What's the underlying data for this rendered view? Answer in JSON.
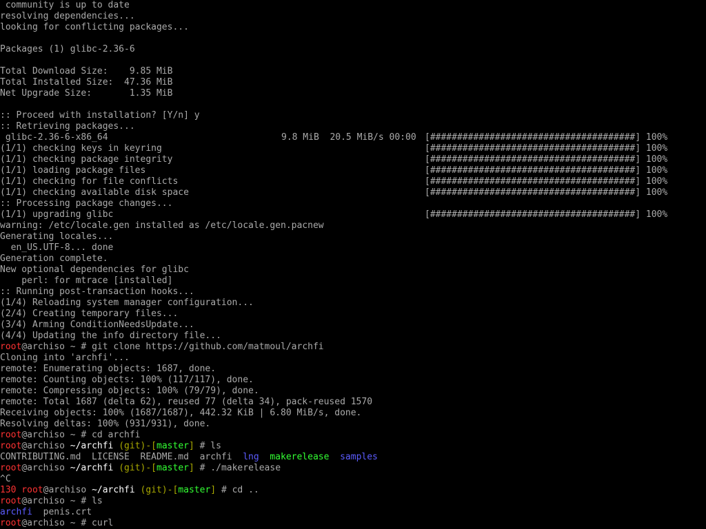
{
  "colors": {
    "background": "#000000",
    "text": "#aaaaaa",
    "prompt_user": "#ff3333",
    "path": "#ffffff",
    "git_branch": "#33ff33",
    "git_paren": "#aa55ff",
    "directory": "#5c5cff"
  },
  "lines": [
    {
      "type": "plain",
      "text": " community is up to date"
    },
    {
      "type": "plain",
      "text": "resolving dependencies..."
    },
    {
      "type": "plain",
      "text": "looking for conflicting packages..."
    },
    {
      "type": "plain",
      "text": ""
    },
    {
      "type": "plain",
      "text": "Packages (1) glibc-2.36-6"
    },
    {
      "type": "plain",
      "text": ""
    },
    {
      "type": "plain",
      "text": "Total Download Size:    9.85 MiB"
    },
    {
      "type": "plain",
      "text": "Total Installed Size:  47.36 MiB"
    },
    {
      "type": "plain",
      "text": "Net Upgrade Size:       1.35 MiB"
    },
    {
      "type": "plain",
      "text": ""
    },
    {
      "type": "plain",
      "text": ":: Proceed with installation? [Y/n] y"
    },
    {
      "type": "plain",
      "text": ":: Retrieving packages..."
    },
    {
      "type": "bar",
      "left": " glibc-2.36-6-x86_64",
      "mid": "9.8 MiB  20.5 MiB/s 00:00",
      "bar": "[######################################] 100%"
    },
    {
      "type": "bar",
      "left": "(1/1) checking keys in keyring",
      "mid": "",
      "bar": "[######################################] 100%"
    },
    {
      "type": "bar",
      "left": "(1/1) checking package integrity",
      "mid": "",
      "bar": "[######################################] 100%"
    },
    {
      "type": "bar",
      "left": "(1/1) loading package files",
      "mid": "",
      "bar": "[######################################] 100%"
    },
    {
      "type": "bar",
      "left": "(1/1) checking for file conflicts",
      "mid": "",
      "bar": "[######################################] 100%"
    },
    {
      "type": "bar",
      "left": "(1/1) checking available disk space",
      "mid": "",
      "bar": "[######################################] 100%"
    },
    {
      "type": "plain",
      "text": ":: Processing package changes..."
    },
    {
      "type": "bar",
      "left": "(1/1) upgrading glibc",
      "mid": "",
      "bar": "[######################################] 100%"
    },
    {
      "type": "plain",
      "text": "warning: /etc/locale.gen installed as /etc/locale.gen.pacnew"
    },
    {
      "type": "plain",
      "text": "Generating locales..."
    },
    {
      "type": "plain",
      "text": "  en_US.UTF-8... done"
    },
    {
      "type": "plain",
      "text": "Generation complete."
    },
    {
      "type": "plain",
      "text": "New optional dependencies for glibc"
    },
    {
      "type": "plain",
      "text": "    perl: for mtrace [installed]"
    },
    {
      "type": "plain",
      "text": ":: Running post-transaction hooks..."
    },
    {
      "type": "plain",
      "text": "(1/4) Reloading system manager configuration..."
    },
    {
      "type": "plain",
      "text": "(2/4) Creating temporary files..."
    },
    {
      "type": "plain",
      "text": "(3/4) Arming ConditionNeedsUpdate..."
    },
    {
      "type": "plain",
      "text": "(4/4) Updating the info directory file..."
    },
    {
      "type": "segs",
      "segs": [
        {
          "c": "red",
          "t": "root"
        },
        {
          "c": "default",
          "t": "@archiso "
        },
        {
          "c": "default",
          "t": "~"
        },
        {
          "c": "default",
          "t": " # git clone https://github.com/matmoul/archfi"
        }
      ]
    },
    {
      "type": "plain",
      "text": "Cloning into 'archfi'..."
    },
    {
      "type": "plain",
      "text": "remote: Enumerating objects: 1687, done."
    },
    {
      "type": "plain",
      "text": "remote: Counting objects: 100% (117/117), done."
    },
    {
      "type": "plain",
      "text": "remote: Compressing objects: 100% (79/79), done."
    },
    {
      "type": "plain",
      "text": "remote: Total 1687 (delta 62), reused 77 (delta 34), pack-reused 1570"
    },
    {
      "type": "plain",
      "text": "Receiving objects: 100% (1687/1687), 442.32 KiB | 6.80 MiB/s, done."
    },
    {
      "type": "plain",
      "text": "Resolving deltas: 100% (931/931), done."
    },
    {
      "type": "segs",
      "segs": [
        {
          "c": "red",
          "t": "root"
        },
        {
          "c": "default",
          "t": "@archiso ~ # cd archfi"
        }
      ]
    },
    {
      "type": "segs",
      "segs": [
        {
          "c": "red",
          "t": "root"
        },
        {
          "c": "default",
          "t": "@archiso "
        },
        {
          "c": "white",
          "t": "~/archfi"
        },
        {
          "c": "default",
          "t": " "
        },
        {
          "c": "olive",
          "t": "(git)-["
        },
        {
          "c": "green",
          "t": "master"
        },
        {
          "c": "olive",
          "t": "]"
        },
        {
          "c": "default",
          "t": " # ls"
        }
      ]
    },
    {
      "type": "segs",
      "segs": [
        {
          "c": "default",
          "t": "CONTRIBUTING.md  LICENSE  README.md  archfi  "
        },
        {
          "c": "blue",
          "t": "lng"
        },
        {
          "c": "default",
          "t": "  "
        },
        {
          "c": "green",
          "t": "makerelease"
        },
        {
          "c": "default",
          "t": "  "
        },
        {
          "c": "blue",
          "t": "samples"
        }
      ]
    },
    {
      "type": "segs",
      "segs": [
        {
          "c": "red",
          "t": "root"
        },
        {
          "c": "default",
          "t": "@archiso "
        },
        {
          "c": "white",
          "t": "~/archfi"
        },
        {
          "c": "default",
          "t": " "
        },
        {
          "c": "olive",
          "t": "(git)-["
        },
        {
          "c": "green",
          "t": "master"
        },
        {
          "c": "olive",
          "t": "]"
        },
        {
          "c": "default",
          "t": " # ./makerelease"
        }
      ]
    },
    {
      "type": "plain",
      "text": "^C"
    },
    {
      "type": "segs",
      "segs": [
        {
          "c": "red",
          "t": "130 root"
        },
        {
          "c": "default",
          "t": "@archiso "
        },
        {
          "c": "white",
          "t": "~/archfi"
        },
        {
          "c": "default",
          "t": " "
        },
        {
          "c": "olive",
          "t": "(git)-["
        },
        {
          "c": "green",
          "t": "master"
        },
        {
          "c": "olive",
          "t": "]"
        },
        {
          "c": "default",
          "t": " # cd .."
        }
      ]
    },
    {
      "type": "segs",
      "segs": [
        {
          "c": "red",
          "t": "root"
        },
        {
          "c": "default",
          "t": "@archiso ~ # ls"
        }
      ]
    },
    {
      "type": "segs",
      "segs": [
        {
          "c": "blue",
          "t": "archfi"
        },
        {
          "c": "default",
          "t": "  penis.crt"
        }
      ]
    },
    {
      "type": "segs",
      "segs": [
        {
          "c": "red",
          "t": "root"
        },
        {
          "c": "default",
          "t": "@archiso ~ # curl"
        }
      ]
    }
  ]
}
